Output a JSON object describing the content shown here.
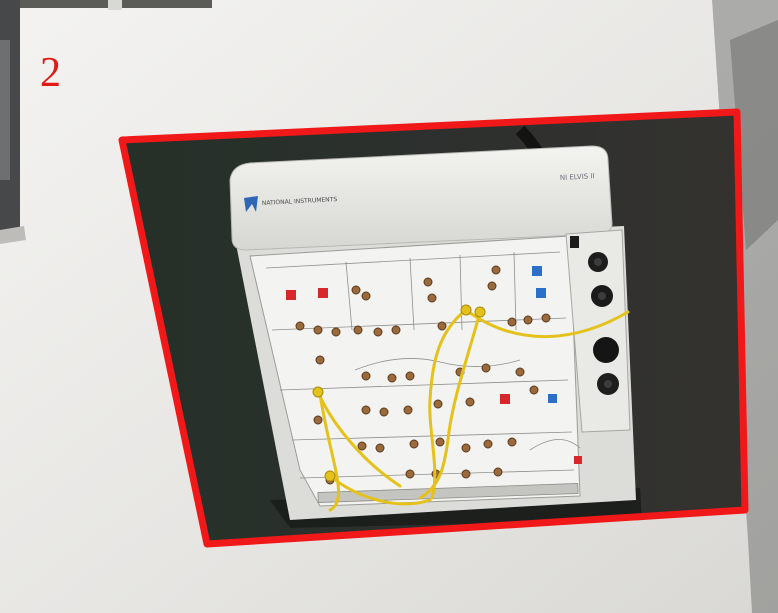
{
  "figure": {
    "number_label": "2",
    "colors": {
      "label_red": "#e01a14",
      "outline_red": "#f01818",
      "wall": "#ecebe8",
      "device_body": "#e9e9e6",
      "board_panel": "#f3f3f1",
      "wire_yellow": "#e4c21b",
      "background_dark": "#2b2e2c"
    },
    "device": {
      "brand_text": "NATIONAL INSTRUMENTS",
      "model_text": "NI ELVIS II"
    }
  }
}
